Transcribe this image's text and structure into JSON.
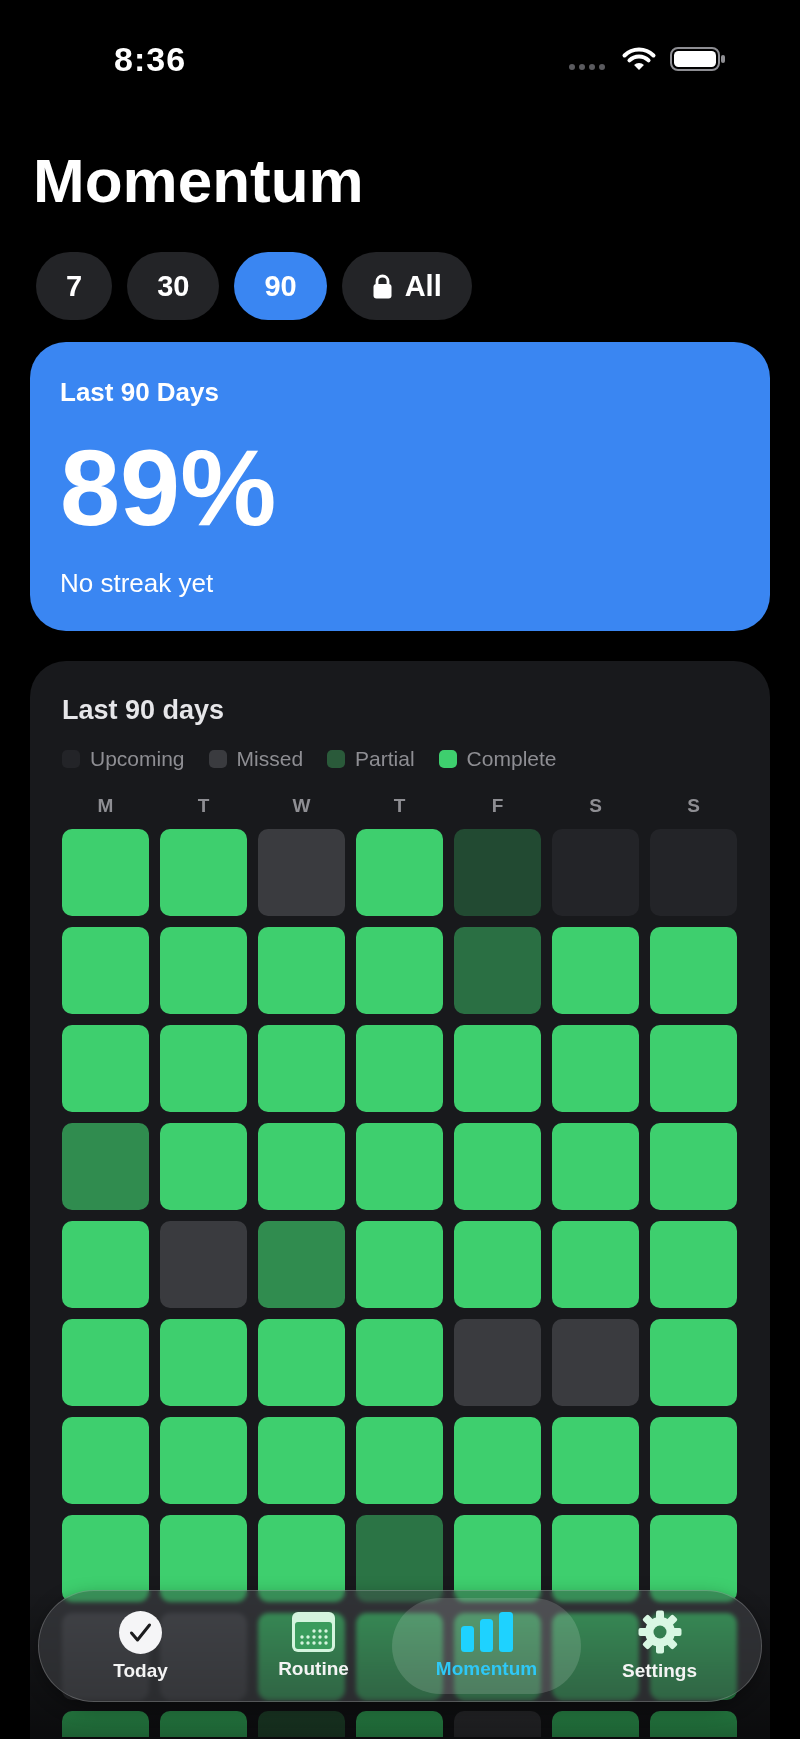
{
  "status_bar": {
    "time": "8:36"
  },
  "title": "Momentum",
  "ranges": [
    {
      "label": "7",
      "selected": false,
      "locked": false
    },
    {
      "label": "30",
      "selected": false,
      "locked": false
    },
    {
      "label": "90",
      "selected": true,
      "locked": false
    },
    {
      "label": "All",
      "selected": false,
      "locked": true
    }
  ],
  "summary": {
    "title": "Last 90 Days",
    "value": "89%",
    "note": "No streak yet"
  },
  "calendar": {
    "title": "Last 90 days",
    "legend": [
      {
        "label": "Upcoming",
        "kind": "upcoming"
      },
      {
        "label": "Missed",
        "kind": "missed"
      },
      {
        "label": "Partial",
        "kind": "partial"
      },
      {
        "label": "Complete",
        "kind": "complete"
      }
    ],
    "weekdays": [
      "M",
      "T",
      "W",
      "T",
      "F",
      "S",
      "S"
    ],
    "weeks": [
      {
        "cells": [
          {
            "kind": "complete"
          },
          {
            "kind": "complete"
          },
          {
            "kind": "missed"
          },
          {
            "kind": "complete"
          },
          {
            "kind": "partial",
            "color": "#224a32"
          },
          {
            "kind": "upcoming"
          },
          {
            "kind": "upcoming"
          }
        ]
      },
      {
        "cells": [
          {
            "kind": "complete"
          },
          {
            "kind": "complete"
          },
          {
            "kind": "complete"
          },
          {
            "kind": "complete"
          },
          {
            "kind": "partial",
            "color": "#2a6f43"
          },
          {
            "kind": "complete"
          },
          {
            "kind": "complete"
          }
        ]
      },
      {
        "cells": [
          {
            "kind": "complete"
          },
          {
            "kind": "complete"
          },
          {
            "kind": "complete"
          },
          {
            "kind": "complete"
          },
          {
            "kind": "complete"
          },
          {
            "kind": "complete"
          },
          {
            "kind": "complete"
          }
        ]
      },
      {
        "cells": [
          {
            "kind": "partial",
            "color": "#308c4f"
          },
          {
            "kind": "complete"
          },
          {
            "kind": "complete"
          },
          {
            "kind": "complete"
          },
          {
            "kind": "complete"
          },
          {
            "kind": "complete"
          },
          {
            "kind": "complete"
          }
        ]
      },
      {
        "cells": [
          {
            "kind": "complete"
          },
          {
            "kind": "missed"
          },
          {
            "kind": "partial",
            "color": "#308c4f"
          },
          {
            "kind": "complete"
          },
          {
            "kind": "complete"
          },
          {
            "kind": "complete"
          },
          {
            "kind": "complete"
          }
        ]
      },
      {
        "cells": [
          {
            "kind": "complete"
          },
          {
            "kind": "complete"
          },
          {
            "kind": "complete"
          },
          {
            "kind": "complete"
          },
          {
            "kind": "missed"
          },
          {
            "kind": "missed"
          },
          {
            "kind": "complete"
          }
        ]
      },
      {
        "cells": [
          {
            "kind": "complete"
          },
          {
            "kind": "complete"
          },
          {
            "kind": "complete"
          },
          {
            "kind": "complete"
          },
          {
            "kind": "complete"
          },
          {
            "kind": "complete"
          },
          {
            "kind": "complete"
          }
        ]
      },
      {
        "cells": [
          {
            "kind": "complete"
          },
          {
            "kind": "complete"
          },
          {
            "kind": "complete"
          },
          {
            "kind": "partial",
            "color": "#2b7445"
          },
          {
            "kind": "complete"
          },
          {
            "kind": "complete"
          },
          {
            "kind": "complete"
          }
        ]
      },
      {
        "cells": [
          {
            "kind": "missed"
          },
          {
            "kind": "missed"
          },
          {
            "kind": "complete"
          },
          {
            "kind": "complete"
          },
          {
            "kind": "complete"
          },
          {
            "kind": "complete"
          },
          {
            "kind": "complete"
          }
        ]
      },
      {
        "cells": [
          {
            "kind": "complete"
          },
          {
            "kind": "complete"
          },
          {
            "kind": "partial"
          },
          {
            "kind": "complete"
          },
          {
            "kind": "missed"
          },
          {
            "kind": "complete"
          },
          {
            "kind": "complete"
          }
        ]
      }
    ]
  },
  "tab_bar": {
    "tabs": [
      {
        "label": "Today",
        "selected": false
      },
      {
        "label": "Routine",
        "selected": false
      },
      {
        "label": "Momentum",
        "selected": true
      },
      {
        "label": "Settings",
        "selected": false
      }
    ]
  }
}
